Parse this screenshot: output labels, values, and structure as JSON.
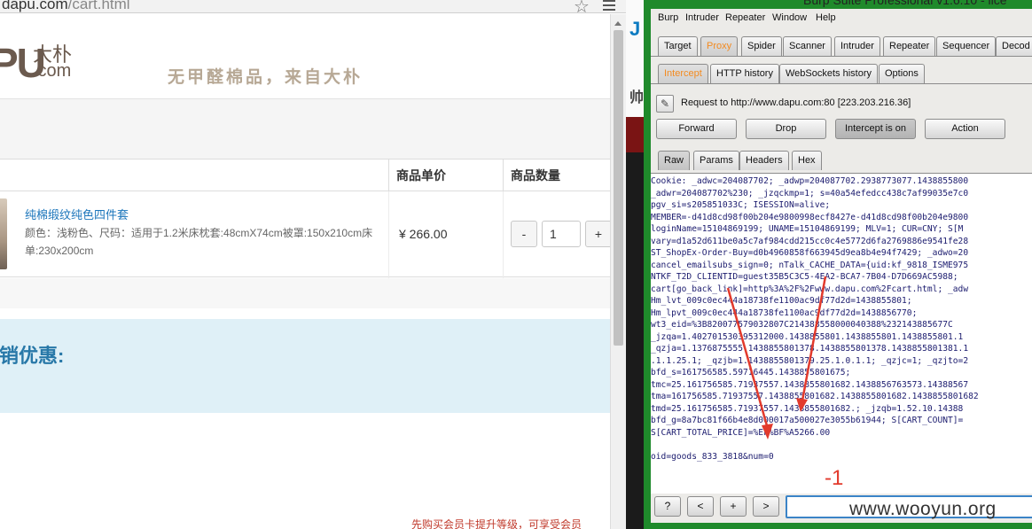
{
  "browser": {
    "address_host": "dapu.com",
    "address_path": "/cart.html",
    "logo_letters": "PU",
    "logo_cn": "大朴",
    "logo_com": ".com",
    "slogan": "无甲醛棉品，来自大朴",
    "table": {
      "col_price": "商品单价",
      "col_qty": "商品数量"
    },
    "product": {
      "name": "纯棉缎纹纯色四件套",
      "spec": "颜色：浅粉色、尺码：适用于1.2米床枕套:48cmX74cm被罩:150x210cm床单:230x200cm",
      "price": "¥ 266.00",
      "qty_minus": "-",
      "qty_value": "1",
      "qty_plus": "+"
    },
    "promo_title": "销优惠:",
    "bottom_note": "先购买会员卡提升等级，可享受会员"
  },
  "gap": {
    "letter": "J",
    "cn": "帅"
  },
  "burp": {
    "title": "Burp Suite Professional v1.6.10 - lice",
    "menu": [
      "Burp",
      "Intruder",
      "Repeater",
      "Window",
      "Help"
    ],
    "main_tabs": [
      "Target",
      "Proxy",
      "Spider",
      "Scanner",
      "Intruder",
      "Repeater",
      "Sequencer",
      "Decod"
    ],
    "proxy_tabs": [
      "Intercept",
      "HTTP history",
      "WebSockets history",
      "Options"
    ],
    "request_to": "Request to http://www.dapu.com:80  [223.203.216.36]",
    "buttons": {
      "forward": "Forward",
      "drop": "Drop",
      "intercept": "Intercept is on",
      "action": "Action"
    },
    "view_tabs": [
      "Raw",
      "Params",
      "Headers",
      "Hex"
    ],
    "raw_lines": [
      "Cookie: _adwc=204087702; _adwp=204087702.2938773077.1438855800",
      "_adwr=204087702%230; _jzqckmp=1; s=40a54efedcc438c7af99035e7c0",
      "pgv_si=s205851033C; ISESSION=alive;",
      "MEMBER=-d41d8cd98f00b204e9800998ecf8427e-d41d8cd98f00b204e9800",
      "loginName=15104869199; UNAME=15104869199; MLV=1; CUR=CNY; S[M",
      "vary=d1a52d611be0a5c7af984cdd215cc0c4e5772d6fa2769886e9541fe28",
      "ST_ShopEx-Order-Buy=d0b4960858f663945d9ea8b4e94f7429; _adwo=20",
      "cancel_emailsubs_sign=0; nTalk_CACHE_DATA={uid:kf_9818_ISME975",
      "NTKF_T2D_CLIENTID=guest35B5C3C5-4EA2-BCA7-7B04-D7D669AC5988;",
      "cart[go_back_link]=http%3A%2F%2Fwww.dapu.com%2Fcart.html; _adw",
      "Hm_lvt_009c0ec444a18738fe1100ac9df77d2d=1438855801;",
      "Hm_lpvt_009c0ec444a18738fe1100ac9df77d2d=1438856770;",
      "wt3_eid=%3B820077579032807C214388558000040388%232143885677C",
      "_jzqa=1.402701530395312000.1438855801.1438855801.1438855801.1",
      "_qzja=1.1376875555.1438855801378.1438855801378.1438855801381.1",
      ".1.1.25.1; _qzjb=1.1438855801379.25.1.0.1.1; _qzjc=1; _qzjto=2",
      "bfd_s=161756585.59716445.1438855801675;",
      "tmc=25.161756585.71937557.1438855801682.1438856763573.14388567",
      "tma=161756585.71937557.1438855801682.1438855801682.1438855801682",
      "tmd=25.161756585.71937557.1438855801682.; _jzqb=1.52.10.14388",
      "bfd_g=8a7bc81f66b4e8d000017a500027e3055b61944; S[CART_COUNT]=",
      "S[CART_TOTAL_PRICE]=%EF%BF%A5266.00",
      "",
      "oid=goods_833_3818&num=0"
    ],
    "annotation": "-1",
    "nav": {
      "help": "?",
      "prev": "<",
      "add": "+",
      "next": ">"
    },
    "watermark": "www.wooyun.org",
    "colors": {
      "frame_green": "#1f8a2b",
      "accent_orange": "#f38a1f",
      "arrow_red": "#e23a2c"
    }
  }
}
